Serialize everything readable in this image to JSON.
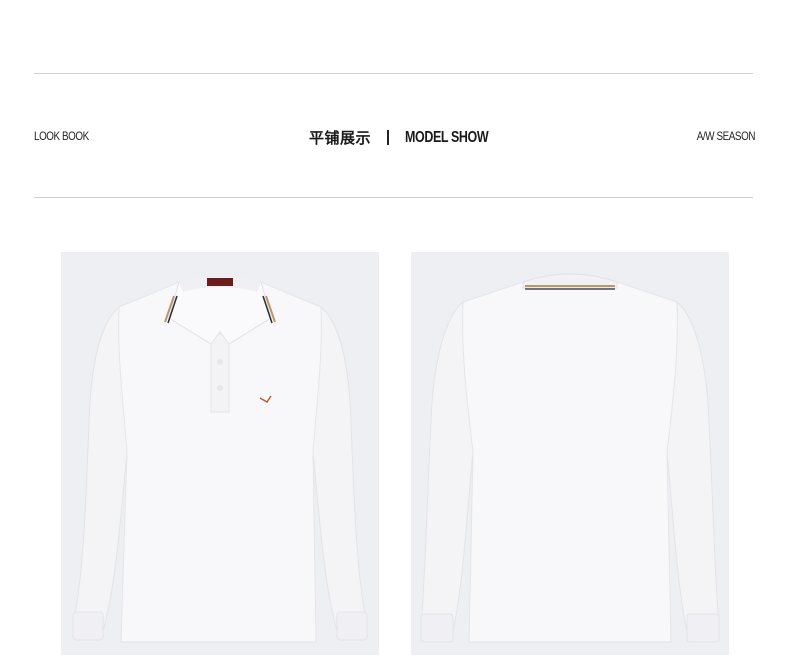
{
  "header": {
    "left_label": "LOOK BOOK",
    "center_cn": "平铺展示",
    "center_en": "MODEL SHOW",
    "right_label": "A/W SEASON"
  },
  "products": [
    {
      "view": "front",
      "image": "white long-sleeve polo shirt front"
    },
    {
      "view": "back",
      "image": "white long-sleeve polo shirt back"
    }
  ],
  "colors": {
    "rule": "#cfcfcf",
    "photo_bg": "#eeeff3",
    "shirt": "#f7f7f9",
    "stripe_gold": "#b89a6a",
    "stripe_dark": "#2b2b3a"
  }
}
